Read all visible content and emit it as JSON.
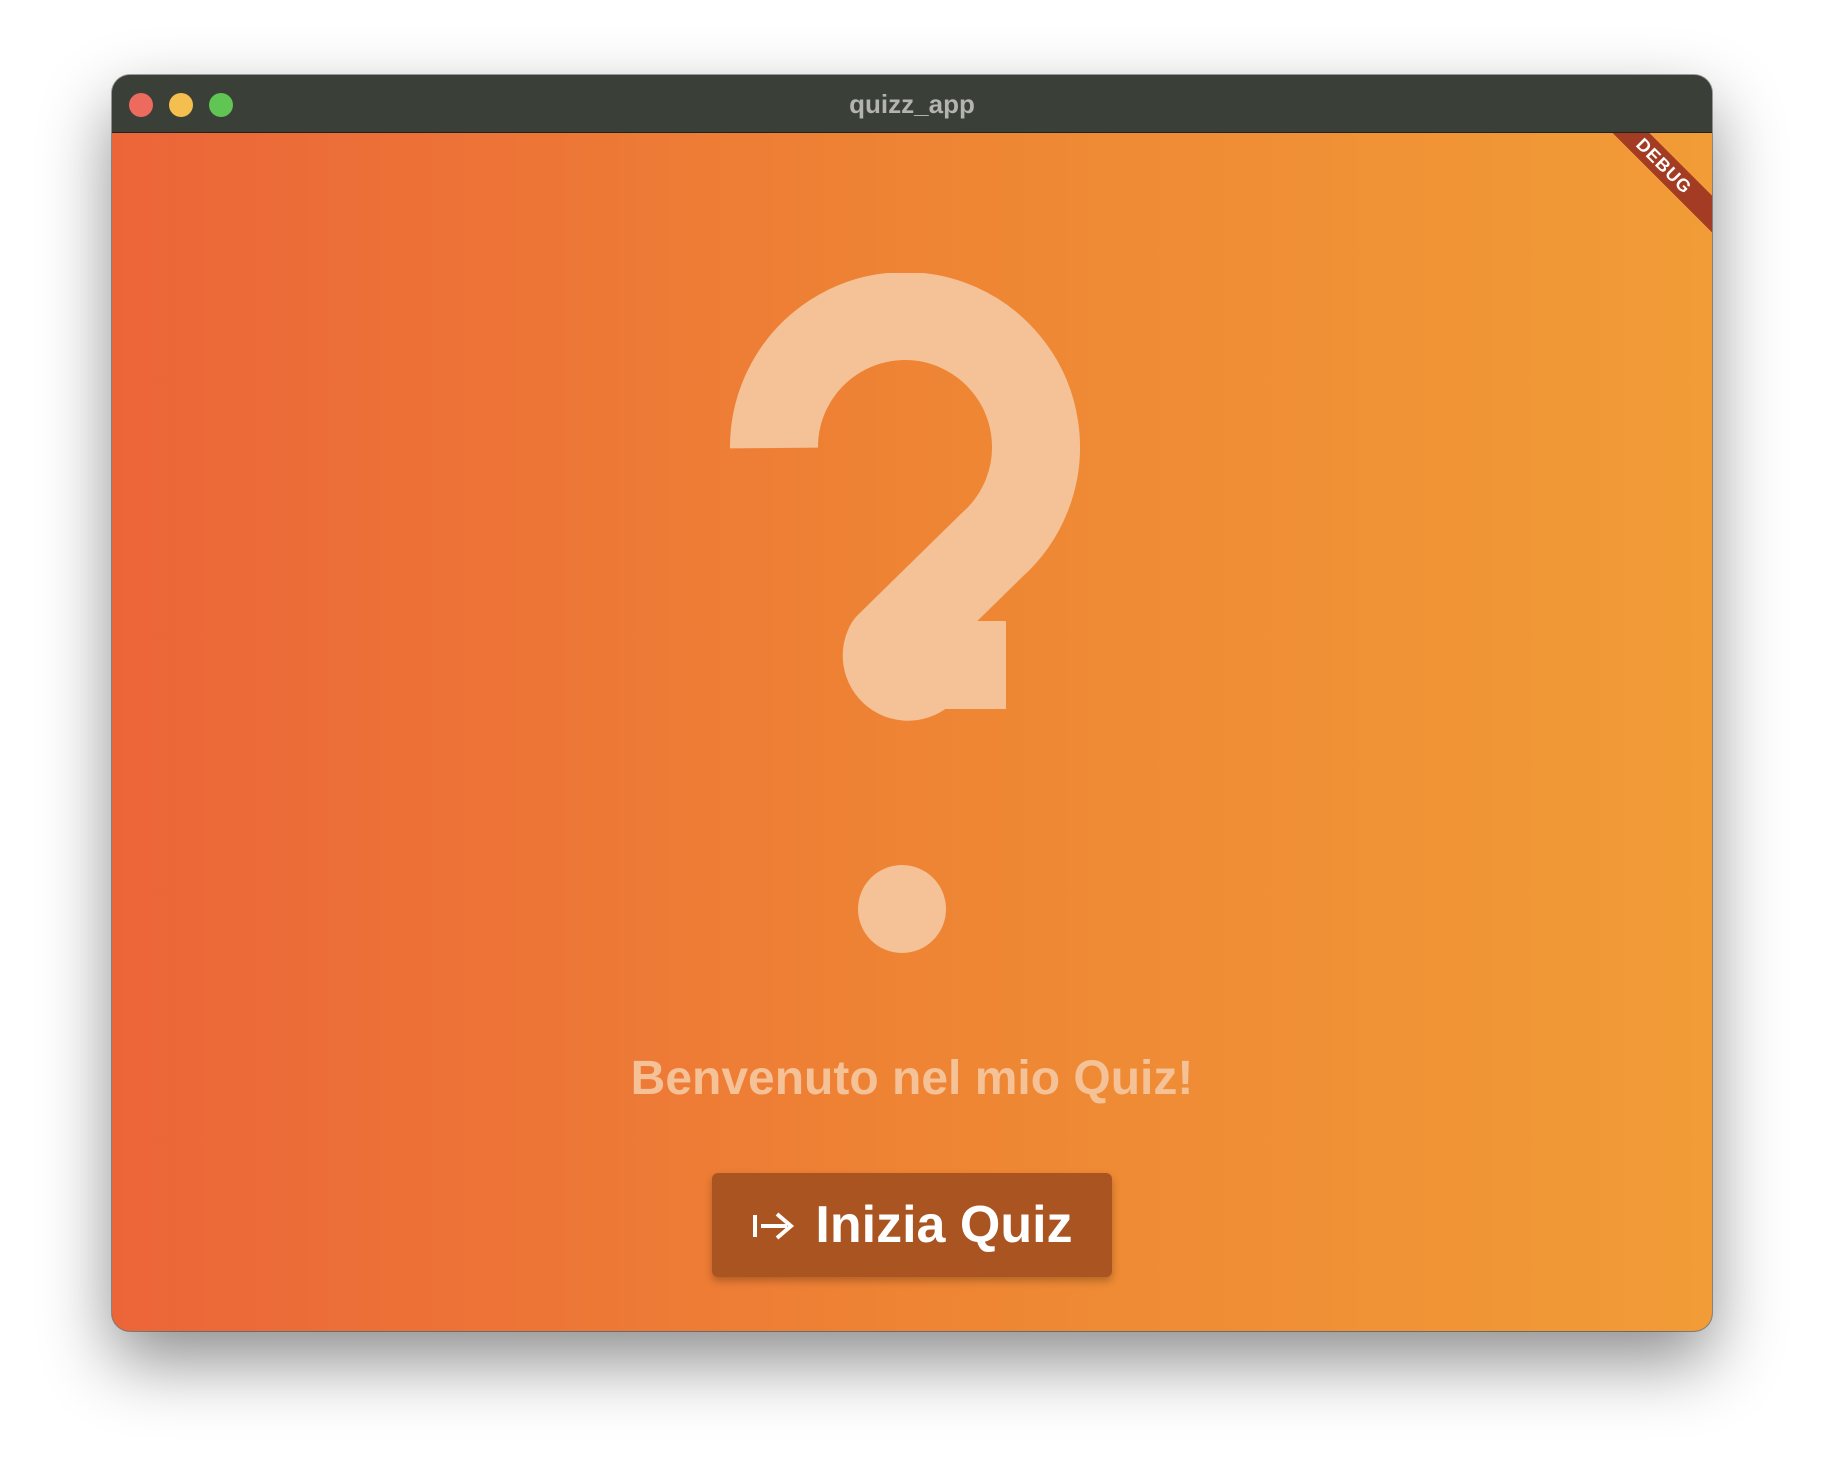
{
  "window": {
    "title": "quizz_app",
    "traffic_lights": {
      "close_color": "#ec6a5e",
      "minimize_color": "#f4bf4f",
      "maximize_color": "#61c554"
    }
  },
  "debug_banner": {
    "label": "DEBUG",
    "color": "#a43b23"
  },
  "main": {
    "hero_icon": "question-mark-icon",
    "hero_icon_color": "#f5c196",
    "welcome_text": "Benvenuto nel mio Quiz!",
    "start_button": {
      "icon": "arrow-right-from-bar-icon",
      "label": "Inizia Quiz",
      "background": "#a95421"
    },
    "background_gradient": [
      "#ec6539",
      "#f19c37"
    ]
  }
}
